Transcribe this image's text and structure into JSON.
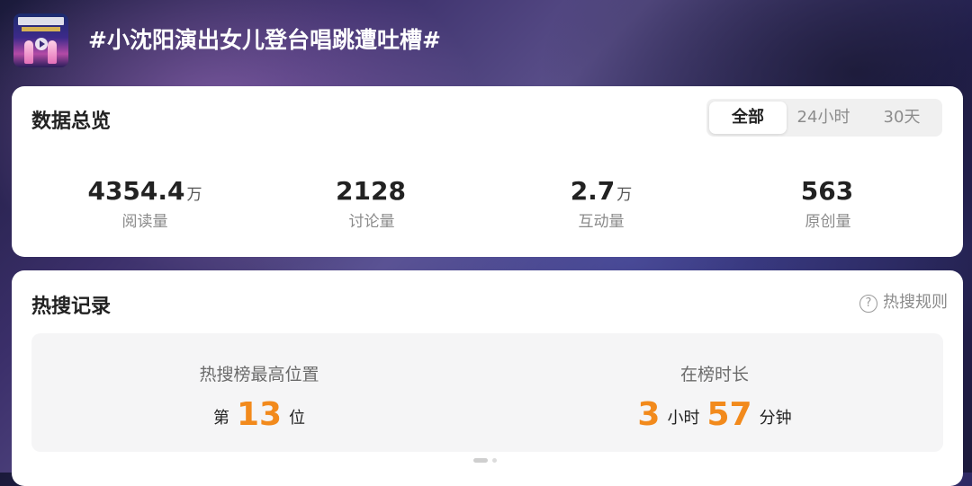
{
  "header": {
    "title": "#小沈阳演出女儿登台唱跳遭吐槽#"
  },
  "overview": {
    "heading": "数据总览",
    "tabs": [
      {
        "label": "全部",
        "active": true
      },
      {
        "label": "24小时",
        "active": false
      },
      {
        "label": "30天",
        "active": false
      }
    ],
    "stats": [
      {
        "value": "4354.4",
        "unit": "万",
        "label": "阅读量"
      },
      {
        "value": "2128",
        "unit": "",
        "label": "讨论量"
      },
      {
        "value": "2.7",
        "unit": "万",
        "label": "互动量"
      },
      {
        "value": "563",
        "unit": "",
        "label": "原创量"
      }
    ]
  },
  "hot_search": {
    "heading": "热搜记录",
    "rules_label": "热搜规则",
    "peak": {
      "title": "热搜榜最高位置",
      "prefix": "第",
      "value": "13",
      "suffix": "位"
    },
    "duration": {
      "title": "在榜时长",
      "hours": "3",
      "hours_unit": "小时",
      "minutes": "57",
      "minutes_unit": "分钟"
    }
  },
  "colors": {
    "accent_orange": "#f28a1c",
    "text_primary": "#222222",
    "text_secondary": "#8a8a8a"
  },
  "icons": {
    "video_thumbnail": "video-thumbnail",
    "help": "question-circle-icon",
    "play": "play-icon"
  }
}
